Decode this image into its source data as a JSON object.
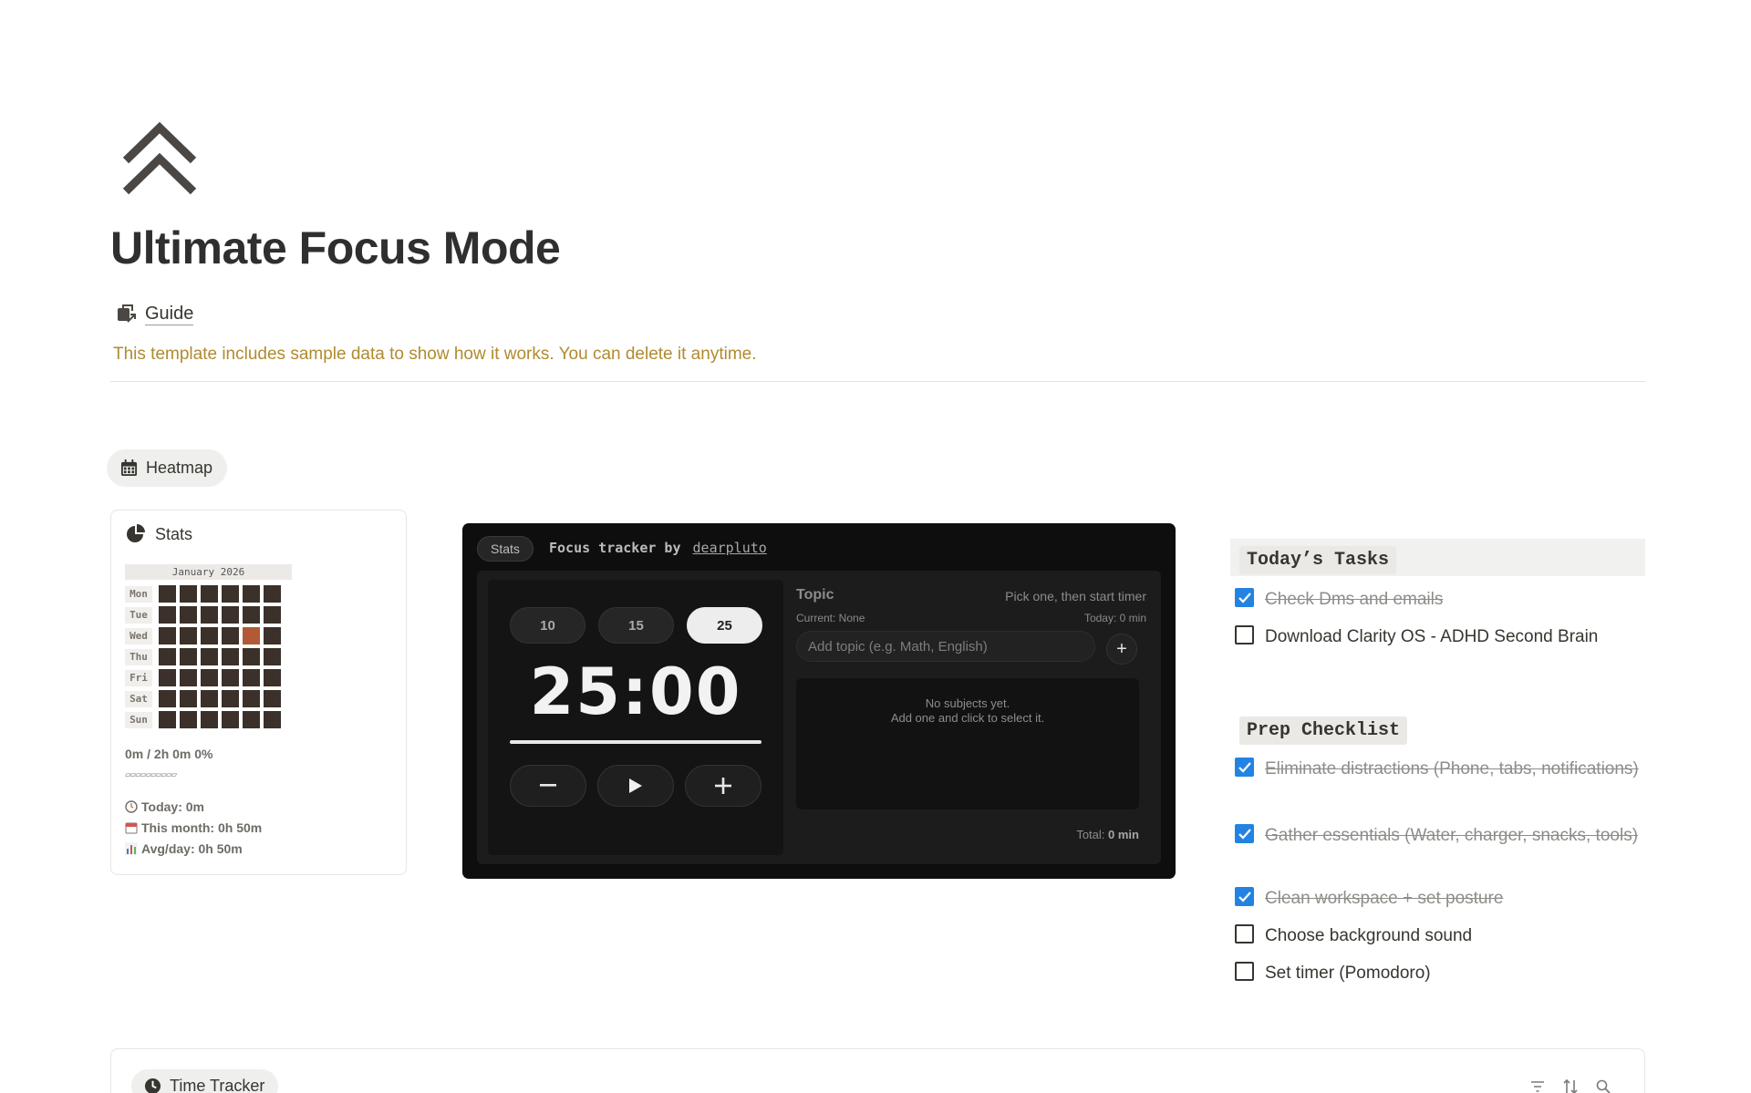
{
  "page": {
    "title": "Ultimate Focus Mode",
    "icon": "double-chevron-up-icon",
    "guide_label": "Guide",
    "callout": "This template includes sample data to show how it works. You can delete it anytime."
  },
  "heatmap_tab": {
    "label": "Heatmap",
    "icon": "calendar-icon"
  },
  "stats": {
    "title": "Stats",
    "icon": "pie-chart-icon",
    "month": "January 2026",
    "days": [
      "Mon",
      "Tue",
      "Wed",
      "Thu",
      "Fri",
      "Sat",
      "Sun"
    ],
    "progress": "0m / 2h 0m  0%",
    "progress_bar": "▱▱▱▱▱▱▱▱▱▱",
    "today": "Today: 0m",
    "this_month": "This month: 0h 50m",
    "avg_day": "Avg/day: 0h 50m",
    "colors": {
      "empty_cell": "#3b302a",
      "active_cell": "#b25a35"
    }
  },
  "tracker": {
    "stats_button": "Stats",
    "title": "Focus tracker by",
    "author": "dearpluto",
    "durations": [
      "10",
      "15",
      "25"
    ],
    "selected_duration": "25",
    "time": "25:00",
    "minus": "−",
    "plus": "+",
    "topic_title": "Topic",
    "topic_hint": "Pick one, then start timer",
    "current": "Current: None",
    "today": "Today: 0 min",
    "topic_placeholder": "Add topic (e.g. Math, English)",
    "add": "+",
    "empty_line1": "No subjects yet.",
    "empty_line2": "Add one and click to select it.",
    "total_label": "Total:",
    "total_value": "0 min"
  },
  "todays_tasks": {
    "title": "Today’s Tasks",
    "items": [
      {
        "label": "Check Dms and emails",
        "checked": true
      },
      {
        "label": "Download Clarity OS - ADHD Second Brain",
        "checked": false
      }
    ]
  },
  "prep_checklist": {
    "title": "Prep Checklist",
    "items": [
      {
        "label": "Eliminate distractions (Phone, tabs, notifications)",
        "checked": true
      },
      {
        "label": "Gather essentials (Water, charger, snacks, tools)",
        "checked": true
      },
      {
        "label": "Clean workspace + set posture",
        "checked": true
      },
      {
        "label": "Choose background sound",
        "checked": false
      },
      {
        "label": "Set timer (Pomodoro)",
        "checked": false
      }
    ]
  },
  "time_tracker": {
    "label": "Time Tracker",
    "icon": "clock-icon",
    "tools": [
      "filter-icon",
      "sort-icon",
      "search-icon"
    ]
  }
}
